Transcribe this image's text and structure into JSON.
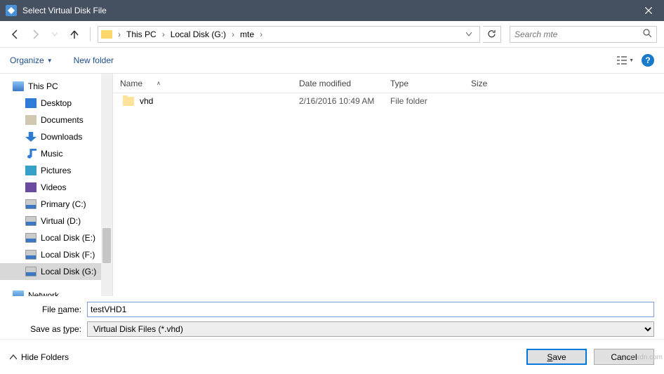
{
  "window": {
    "title": "Select Virtual Disk File"
  },
  "breadcrumb": {
    "items": [
      "This PC",
      "Local Disk (G:)",
      "mte"
    ]
  },
  "search": {
    "placeholder": "Search mte"
  },
  "toolbar": {
    "organize": "Organize",
    "new_folder": "New folder"
  },
  "columns": {
    "name": "Name",
    "date": "Date modified",
    "type": "Type",
    "size": "Size"
  },
  "tree": {
    "root": "This PC",
    "items": [
      "Desktop",
      "Documents",
      "Downloads",
      "Music",
      "Pictures",
      "Videos",
      "Primary (C:)",
      "Virtual (D:)",
      "Local Disk (E:)",
      "Local Disk (F:)",
      "Local Disk (G:)"
    ],
    "network": "Network"
  },
  "files": [
    {
      "name": "vhd",
      "date": "2/16/2016 10:49 AM",
      "type": "File folder"
    }
  ],
  "form": {
    "filename_label_pre": "File ",
    "filename_label_u": "n",
    "filename_label_post": "ame:",
    "filename_value": "testVHD1",
    "type_label_pre": "Save as ",
    "type_label_u": "t",
    "type_label_post": "ype:",
    "type_value": "Virtual Disk Files (*.vhd)"
  },
  "footer": {
    "hide": "Hide Folders",
    "save_pre": "",
    "save_u": "S",
    "save_post": "ave",
    "cancel": "Cancel"
  },
  "watermark": "wsxdn.com"
}
